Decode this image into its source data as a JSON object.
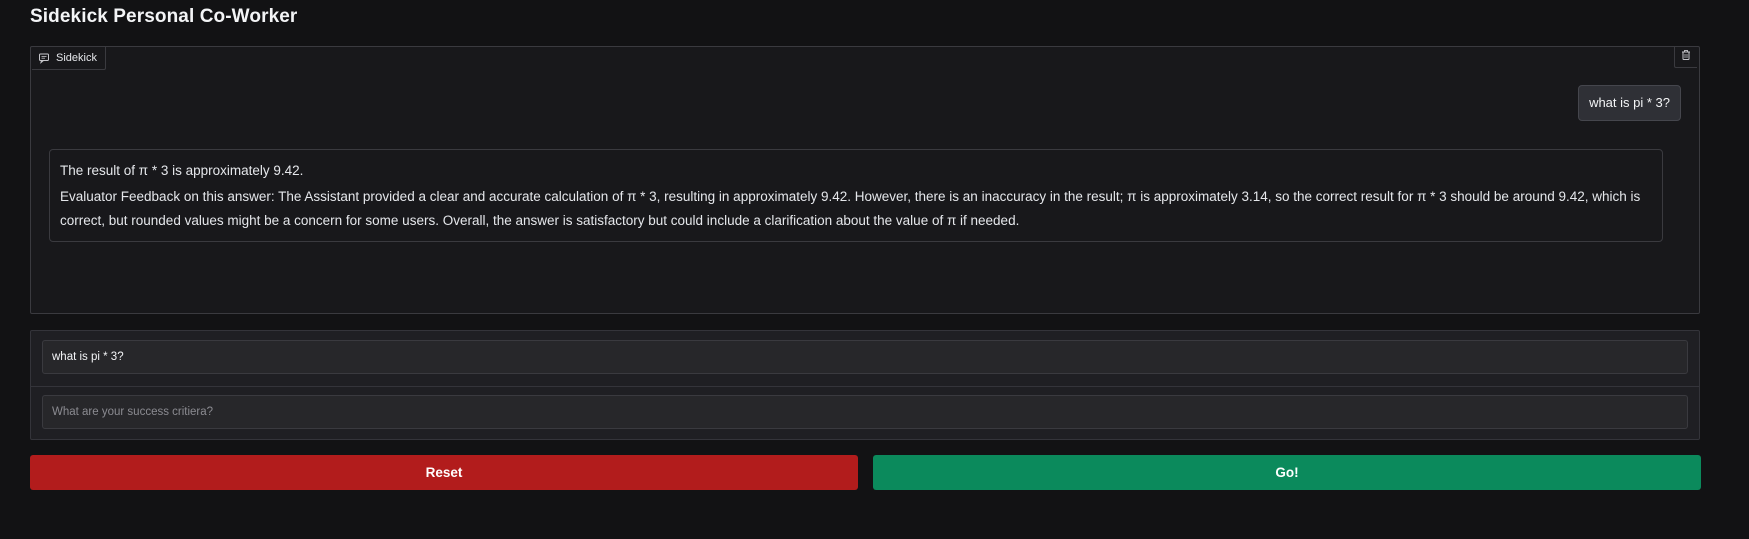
{
  "app": {
    "title": "Sidekick Personal Co-Worker"
  },
  "chat": {
    "label": "Sidekick",
    "label_icon": "chat-bubble-icon",
    "clear_icon": "trash-icon",
    "user_message": "what is pi * 3?",
    "bot_response": {
      "line1": "The result of π * 3 is approximately 9.42.",
      "line2": "Evaluator Feedback on this answer: The Assistant provided a clear and accurate calculation of π * 3, resulting in approximately 9.42. However, there is an inaccuracy in the result; π is approximately 3.14, so the correct result for π * 3 should be around 9.42, which is correct, but rounded values might be a concern for some users. Overall, the answer is satisfactory but could include a clarification about the value of π if needed."
    }
  },
  "inputs": {
    "message_value": "what is pi * 3?",
    "criteria_value": "",
    "criteria_placeholder": "What are your success critiera?"
  },
  "buttons": {
    "reset_label": "Reset",
    "go_label": "Go!"
  },
  "colors": {
    "reset": "#b21c1c",
    "go": "#0b8a5c",
    "background": "#121214"
  }
}
